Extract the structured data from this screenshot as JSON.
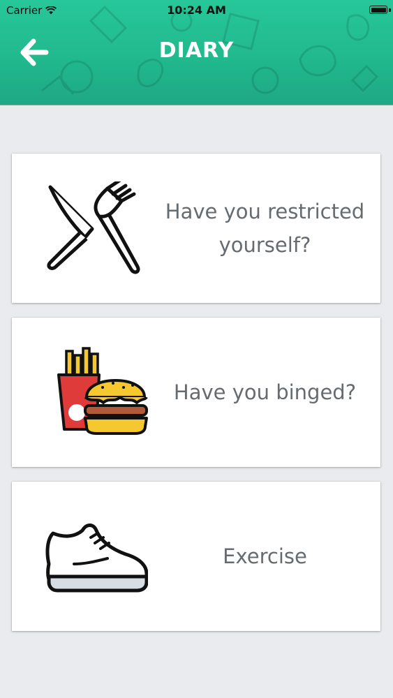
{
  "status_bar": {
    "carrier": "Carrier",
    "time": "10:24 AM",
    "wifi_icon": "wifi-icon",
    "battery_icon": "battery-icon"
  },
  "header": {
    "title": "DIARY",
    "back_icon": "arrow-left-icon",
    "color_top": "#27c79a",
    "color_bottom": "#1ea884"
  },
  "cards": [
    {
      "label": "Have you restricted yourself?",
      "icon": "knife-fork-icon"
    },
    {
      "label": "Have you binged?",
      "icon": "burger-fries-icon"
    },
    {
      "label": "Exercise",
      "icon": "sneaker-icon"
    }
  ],
  "colors": {
    "background": "#e9ebee",
    "card": "#ffffff",
    "card_text": "#666b70",
    "fries_box": "#e03b3b",
    "fries": "#f5c82f"
  }
}
